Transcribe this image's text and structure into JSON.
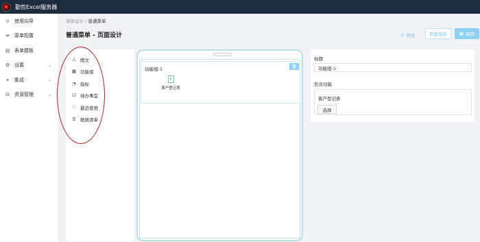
{
  "app": {
    "title": "勤哲Excel服务器"
  },
  "sidebar": {
    "items": [
      {
        "icon": "⊙",
        "label": "使用向导",
        "chevron": ""
      },
      {
        "icon": "⇎",
        "label": "菜单配置",
        "chevron": ""
      },
      {
        "icon": "▤",
        "label": "表单模板",
        "chevron": ""
      },
      {
        "icon": "⚙",
        "label": "设置",
        "chevron": "⌄"
      },
      {
        "icon": "⚭",
        "label": "集成",
        "chevron": "⌄"
      },
      {
        "icon": "⊟",
        "label": "资源管理",
        "chevron": "⌄"
      }
    ]
  },
  "breadcrumb": {
    "parent": "菜单设计",
    "separator": "/",
    "current": "普通菜单"
  },
  "page": {
    "title": "普通菜单 - 页面设计"
  },
  "toolbar": {
    "preview_icon": "◎",
    "preview_label": "预览",
    "layout_label": "页面布局",
    "save_icon": "▣",
    "save_label": "保存"
  },
  "palette": {
    "items": [
      {
        "icon": "⚠",
        "label": "图文"
      },
      {
        "icon": "▦",
        "label": "功能组"
      },
      {
        "icon": "◔",
        "label": "指标"
      },
      {
        "icon": "☑",
        "label": "待办事宜"
      },
      {
        "icon": "♡",
        "label": "最近使用"
      },
      {
        "icon": "☰",
        "label": "数据清单"
      }
    ]
  },
  "preview": {
    "group_title": "功能组-1",
    "delete_icon": "🗑",
    "entry_icon": "E",
    "entry_label": "客户登记表"
  },
  "properties": {
    "title_label": "标题",
    "title_value": "功能组-1",
    "functions_label": "包含功能",
    "functions_value": "客户登记表",
    "select_label": "选择"
  }
}
